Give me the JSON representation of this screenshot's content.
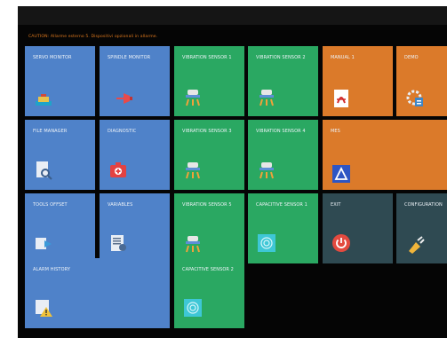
{
  "alarm_banner": "CAUTION: Allarme esterno 5. Dispositivi opzionali in allarme.",
  "tiles": {
    "servo_monitor": {
      "label": "SERVO MONITOR",
      "icon": "servo-icon"
    },
    "spindle_monitor": {
      "label": "SPINDLE MONITOR",
      "icon": "spindle-icon"
    },
    "vibration_1": {
      "label": "VIBRATION SENSOR 1",
      "icon": "vibration-sensor-icon"
    },
    "vibration_2": {
      "label": "VIBRATION SENSOR 2",
      "icon": "vibration-sensor-icon"
    },
    "manual_1": {
      "label": "MANUAL 1",
      "icon": "pdf-icon"
    },
    "demo": {
      "label": "DEMO",
      "icon": "gear-document-icon"
    },
    "file_manager": {
      "label": "FILE MANAGER",
      "icon": "file-search-icon"
    },
    "diagnostic": {
      "label": "DIAGNOSTIC",
      "icon": "first-aid-icon"
    },
    "vibration_3": {
      "label": "VIBRATION SENSOR 3",
      "icon": "vibration-sensor-icon"
    },
    "vibration_4": {
      "label": "VIBRATION SENSOR 4",
      "icon": "vibration-sensor-icon"
    },
    "mes": {
      "label": "MES",
      "icon": "mes-triangle-icon"
    },
    "tools_offset": {
      "label": "TOOLS OFFSET",
      "icon": "tools-offset-icon"
    },
    "variables": {
      "label": "VARIABLES",
      "icon": "variables-icon"
    },
    "vibration_5": {
      "label": "VIBRATION SENSOR 5",
      "icon": "vibration-sensor-icon"
    },
    "capacitive_1": {
      "label": "CAPACITIVE SENSOR 1",
      "icon": "capacitive-sensor-icon"
    },
    "exit": {
      "label": "EXIT",
      "icon": "power-icon"
    },
    "configuration": {
      "label": "CONFIGURATION",
      "icon": "plug-icon"
    },
    "alarm_history": {
      "label": "ALARM HISTORY",
      "icon": "alarm-history-icon"
    },
    "capacitive_2": {
      "label": "CAPACITIVE SENSOR 2",
      "icon": "capacitive-sensor-icon"
    }
  },
  "colors": {
    "blue": "#4f82c9",
    "green": "#2aa862",
    "orange": "#db7a2a",
    "dark": "#2f4a52",
    "alarm": "#e07a1e"
  }
}
